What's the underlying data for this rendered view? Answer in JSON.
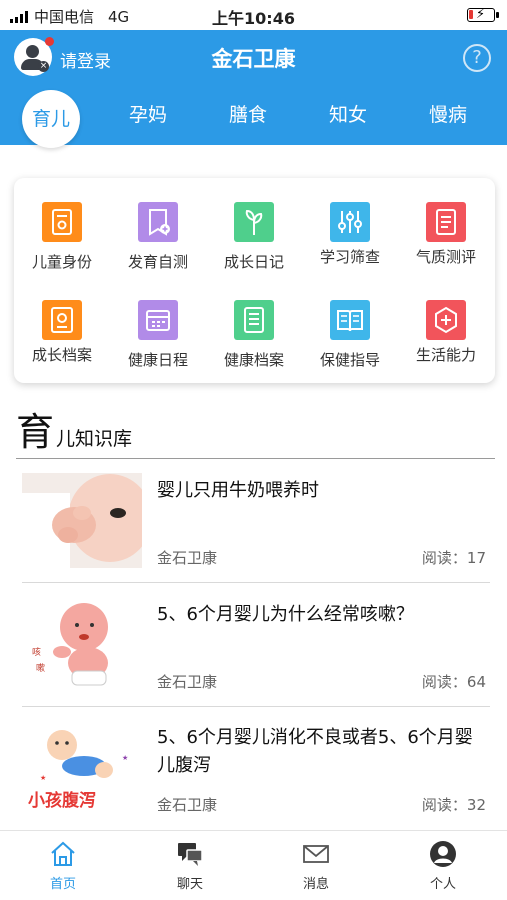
{
  "status_bar": {
    "carrier": "中国电信",
    "network": "4G",
    "time": "上午10:46"
  },
  "header": {
    "login_label": "请登录",
    "app_title": "金石卫康",
    "help_symbol": "?",
    "accent_color": "#2c9ae6"
  },
  "tabs": [
    {
      "label": "育儿",
      "active": true
    },
    {
      "label": "孕妈",
      "active": false
    },
    {
      "label": "膳食",
      "active": false
    },
    {
      "label": "知女",
      "active": false
    },
    {
      "label": "慢病",
      "active": false
    }
  ],
  "features": [
    {
      "label": "儿童身份",
      "icon": "child-id-icon",
      "color": "#ff8c1a"
    },
    {
      "label": "发育自测",
      "icon": "development-test-icon",
      "color": "#b18be8"
    },
    {
      "label": "成长日记",
      "icon": "sprout-icon",
      "color": "#4fcf8c"
    },
    {
      "label": "学习筛查",
      "icon": "sliders-icon",
      "color": "#3fb6ea"
    },
    {
      "label": "气质测评",
      "icon": "checklist-icon",
      "color": "#f2545b"
    },
    {
      "label": "成长档案",
      "icon": "certificate-icon",
      "color": "#ff8c1a"
    },
    {
      "label": "健康日程",
      "icon": "calendar-icon",
      "color": "#b18be8"
    },
    {
      "label": "健康档案",
      "icon": "file-icon",
      "color": "#4fcf8c"
    },
    {
      "label": "保健指导",
      "icon": "book-icon",
      "color": "#3fb6ea"
    },
    {
      "label": "生活能力",
      "icon": "hexagon-icon",
      "color": "#f2545b"
    }
  ],
  "knowledge": {
    "title_big": "育",
    "title_rest": "儿知识库"
  },
  "articles": [
    {
      "title": "婴儿只用牛奶喂养时",
      "source": "金石卫康",
      "reads": "阅读：17"
    },
    {
      "title": "5、6个月婴儿为什么经常咳嗽？",
      "source": "金石卫康",
      "reads": "阅读：64"
    },
    {
      "title": "5、6个月婴儿消化不良或者5、6个月婴儿腹泻",
      "source": "金石卫康",
      "reads": "阅读：32",
      "thumb_text": "小孩腹泻"
    }
  ],
  "bottom_nav": [
    {
      "label": "首页",
      "icon": "home-icon",
      "active": true
    },
    {
      "label": "聊天",
      "icon": "chat-icon",
      "active": false
    },
    {
      "label": "消息",
      "icon": "mail-icon",
      "active": false
    },
    {
      "label": "个人",
      "icon": "person-icon",
      "active": false
    }
  ]
}
